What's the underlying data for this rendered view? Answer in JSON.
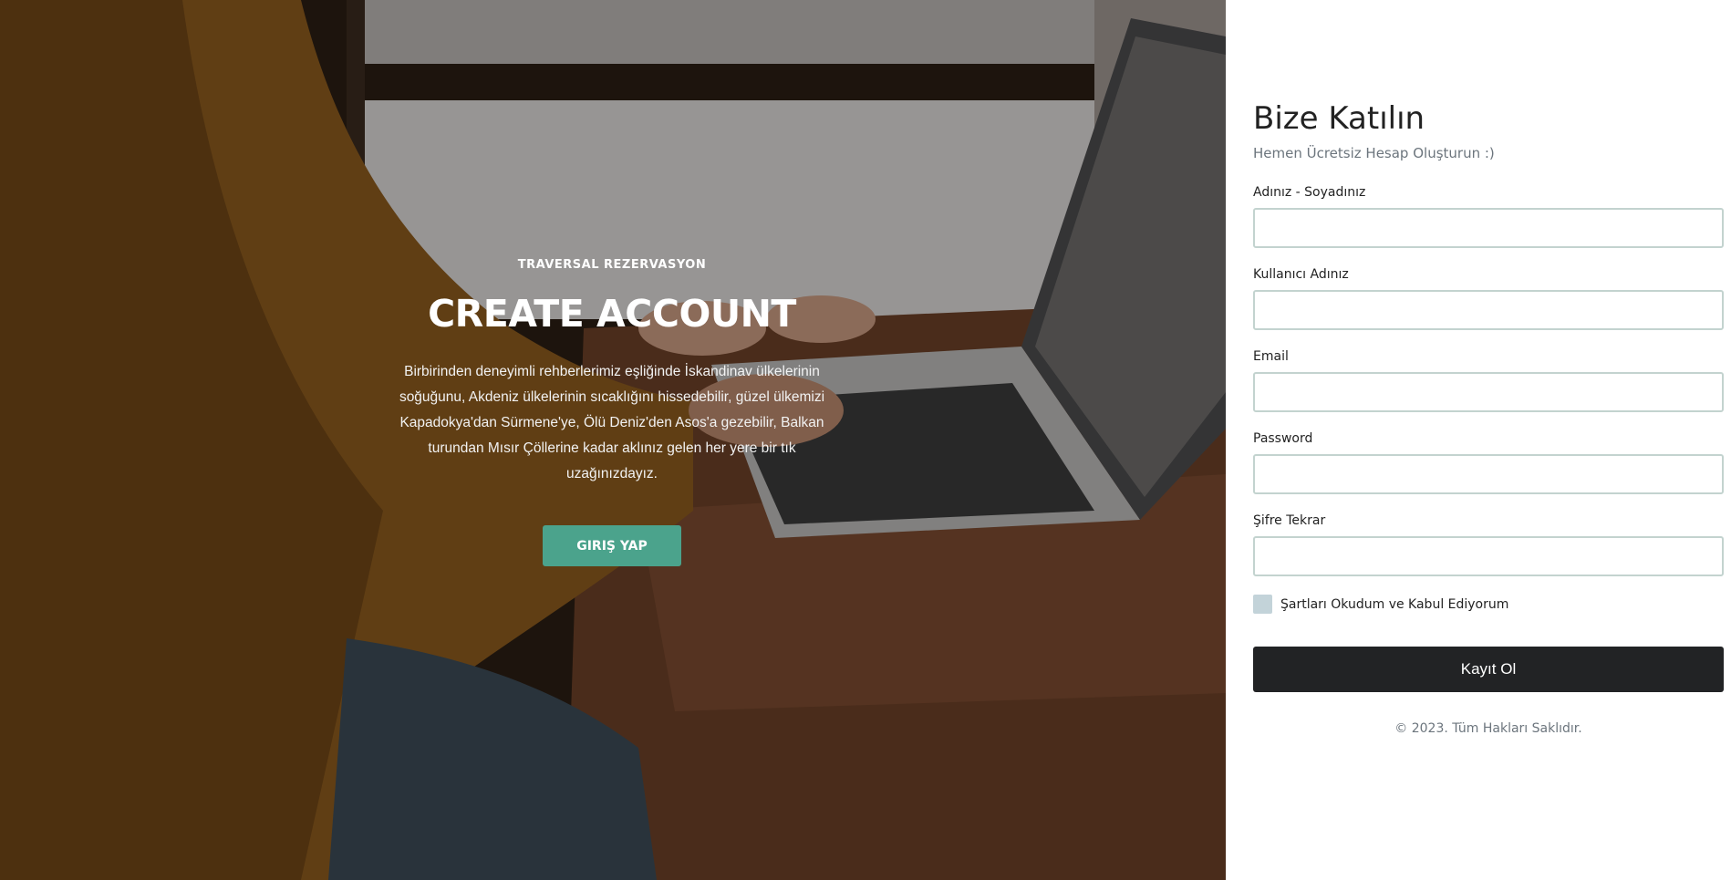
{
  "hero": {
    "kicker": "TRAVERSAL REZERVASYON",
    "title": "CREATE ACCOUNT",
    "description": "Birbirinden deneyimli rehberlerimiz eşliğinde İskandinav ülkelerinin soğuğunu, Akdeniz ülkelerinin sıcaklığını hissedebilir, güzel ülkemizi Kapadokya'dan Sürmene'ye, Ölü Deniz'den Asos'a gezebilir, Balkan turundan Mısır Çöllerine kadar aklınız gelen her yere bir tık uzağınızdayız.",
    "login_button": "GIRIŞ YAP",
    "accent_color": "#4ba38c"
  },
  "form": {
    "title": "Bize Katılın",
    "subtitle": "Hemen Ücretsiz Hesap Oluşturun :)",
    "fields": [
      {
        "label": "Adınız - Soyadınız",
        "value": "",
        "placeholder": ""
      },
      {
        "label": "Kullanıcı Adınız",
        "value": "",
        "placeholder": ""
      },
      {
        "label": "Email",
        "value": "",
        "placeholder": ""
      },
      {
        "label": "Password",
        "value": "",
        "placeholder": ""
      },
      {
        "label": "Şifre Tekrar",
        "value": "",
        "placeholder": ""
      }
    ],
    "terms_label": "Şartları Okudum ve Kabul Ediyorum",
    "terms_checked": false,
    "submit_label": "Kayıt Ol",
    "footer": "© 2023. Tüm Hakları Saklıdır."
  },
  "icons": [
    "laptop-photo"
  ]
}
